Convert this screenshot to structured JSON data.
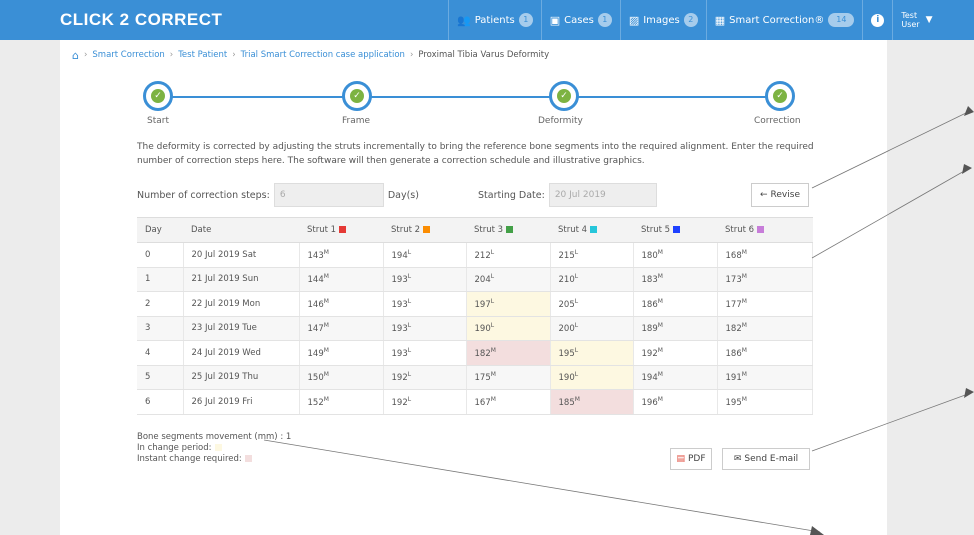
{
  "app": {
    "logo": "CLICK 2 CORRECT"
  },
  "nav": {
    "patients": {
      "label": "Patients",
      "count": "1"
    },
    "cases": {
      "label": "Cases",
      "count": "1"
    },
    "images": {
      "label": "Images",
      "count": "2"
    },
    "smart_correction": {
      "label": "Smart Correction®",
      "count": "14"
    },
    "user": {
      "line1": "Test",
      "line2": "User"
    }
  },
  "breadcrumb": [
    "Smart Correction",
    "Test Patient",
    "Trial Smart Correction case application",
    "Proximal Tibia Varus Deformity"
  ],
  "steps": [
    "Start",
    "Frame",
    "Deformity",
    "Correction"
  ],
  "description": "The deformity is corrected by adjusting the struts incrementally to bring the reference bone segments into the required alignment. Enter the required number of correction steps here. The software will then generate a correction schedule and illustrative graphics.",
  "form": {
    "steps_label": "Number of correction steps:",
    "steps_value": "6",
    "steps_unit": "Day(s)",
    "date_label": "Starting Date:",
    "date_value": "20 Jul 2019",
    "revise_label": "Revise"
  },
  "table": {
    "headers": [
      "Day",
      "Date",
      "Strut 1",
      "Strut 2",
      "Strut 3",
      "Strut 4",
      "Strut 5",
      "Strut 6"
    ],
    "strut_colors": [
      "#e53935",
      "#fb8c00",
      "#43a047",
      "#26c6da",
      "#1e40ff",
      "#c77dd9"
    ],
    "rows": [
      {
        "day": "0",
        "date": "20 Jul 2019 Sat",
        "s": [
          "143",
          "194",
          "212",
          "215",
          "180",
          "168"
        ],
        "u": [
          "M",
          "L",
          "L",
          "L",
          "M",
          "M"
        ],
        "hl": [
          "",
          "",
          "",
          "",
          "",
          ""
        ]
      },
      {
        "day": "1",
        "date": "21 Jul 2019 Sun",
        "s": [
          "144",
          "193",
          "204",
          "210",
          "183",
          "173"
        ],
        "u": [
          "M",
          "L",
          "L",
          "L",
          "M",
          "M"
        ],
        "hl": [
          "",
          "",
          "",
          "",
          "",
          ""
        ]
      },
      {
        "day": "2",
        "date": "22 Jul 2019 Mon",
        "s": [
          "146",
          "193",
          "197",
          "205",
          "186",
          "177"
        ],
        "u": [
          "M",
          "L",
          "L",
          "L",
          "M",
          "M"
        ],
        "hl": [
          "",
          "",
          "y",
          "",
          "",
          ""
        ]
      },
      {
        "day": "3",
        "date": "23 Jul 2019 Tue",
        "s": [
          "147",
          "193",
          "190",
          "200",
          "189",
          "182"
        ],
        "u": [
          "M",
          "L",
          "L",
          "L",
          "M",
          "M"
        ],
        "hl": [
          "",
          "",
          "y",
          "",
          "",
          ""
        ]
      },
      {
        "day": "4",
        "date": "24 Jul 2019 Wed",
        "s": [
          "149",
          "193",
          "182",
          "195",
          "192",
          "186"
        ],
        "u": [
          "M",
          "L",
          "M",
          "L",
          "M",
          "M"
        ],
        "hl": [
          "",
          "",
          "p",
          "y",
          "",
          ""
        ]
      },
      {
        "day": "5",
        "date": "25 Jul 2019 Thu",
        "s": [
          "150",
          "192",
          "175",
          "190",
          "194",
          "191"
        ],
        "u": [
          "M",
          "L",
          "M",
          "L",
          "M",
          "M"
        ],
        "hl": [
          "",
          "",
          "",
          "y",
          "",
          ""
        ]
      },
      {
        "day": "6",
        "date": "26 Jul 2019 Fri",
        "s": [
          "152",
          "192",
          "167",
          "185",
          "196",
          "195"
        ],
        "u": [
          "M",
          "L",
          "M",
          "M",
          "M",
          "M"
        ],
        "hl": [
          "",
          "",
          "",
          "p",
          "",
          ""
        ]
      }
    ]
  },
  "legend": {
    "movement": "Bone segments movement (mm) : 1",
    "change_period": "In change period:",
    "instant_change": "Instant change required:",
    "change_color": "#fdf8e1",
    "instant_color": "#f3dede"
  },
  "actions": {
    "pdf": "PDF",
    "email": "Send E-mail"
  },
  "colors": {
    "brand": "#3a8fd6",
    "check": "#7db342"
  }
}
